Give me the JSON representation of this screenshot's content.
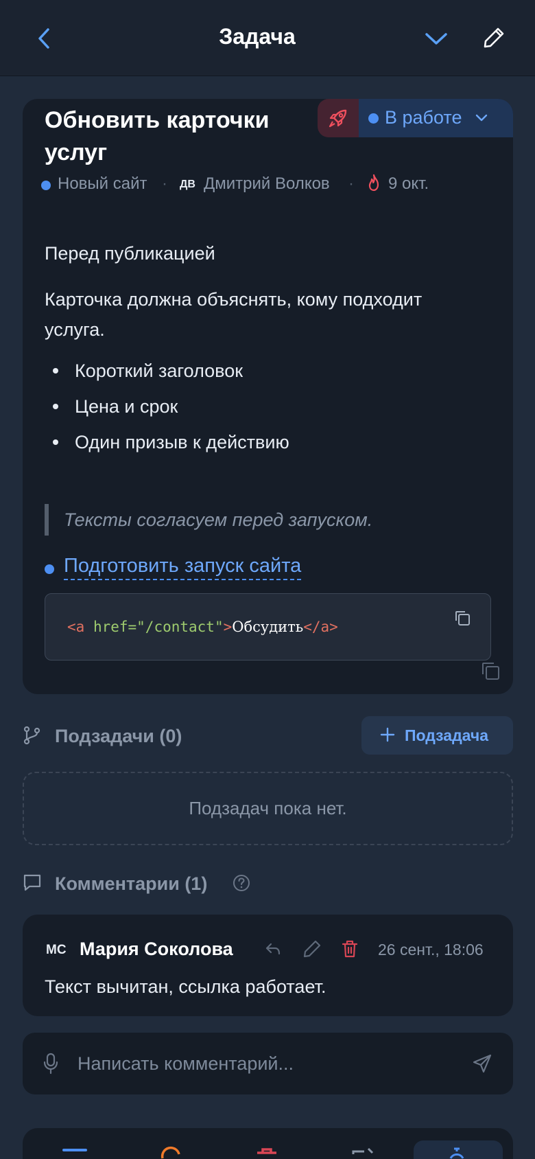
{
  "header": {
    "title": "Задача"
  },
  "task": {
    "title": "Обновить карточки услуг",
    "status_label": "В работе",
    "status_color": "#4d8ff2",
    "priority_color": "#f0505e",
    "project": "Новый сайт",
    "assignee_initials": "ДВ",
    "assignee": "Дмитрий Волков",
    "due": "9 окт.",
    "separator": "·",
    "description": {
      "heading": "Перед публикацией",
      "paragraph": "Карточка должна объяснять, кому подходит услуга.",
      "list": [
        "Короткий заголовок",
        "Цена и срок",
        "Один призыв к действию"
      ],
      "quote": "Тексты согласуем перед запуском.",
      "linked_task": "Подготовить запуск сайта",
      "code": {
        "open_tag_start": "<a",
        "attr_name": " href=",
        "attr_value": "\"/contact\"",
        "open_tag_end": ">",
        "inner_text": "Обсудить",
        "close_tag": "</a>"
      }
    }
  },
  "subtasks": {
    "label": "Подзадачи (0)",
    "add_label": "Подзадача",
    "empty_text": "Подзадач пока нет."
  },
  "comments": {
    "label": "Комментарии (1)",
    "items": [
      {
        "initials": "МС",
        "author": "Мария Соколова",
        "time": "26 сент., 18:06",
        "text": "Текст вычитан, ссылка работает."
      }
    ],
    "composer_placeholder": "Написать комментарий..."
  },
  "bottom_nav": {
    "icons": [
      "list-icon",
      "clock-icon",
      "briefcase-icon",
      "edit-square-icon",
      "stopwatch-icon"
    ],
    "active_index": 4
  },
  "colors": {
    "accent": "#4d8ff2",
    "danger": "#e0505e",
    "background": "#202b3b",
    "card": "#161d28"
  }
}
